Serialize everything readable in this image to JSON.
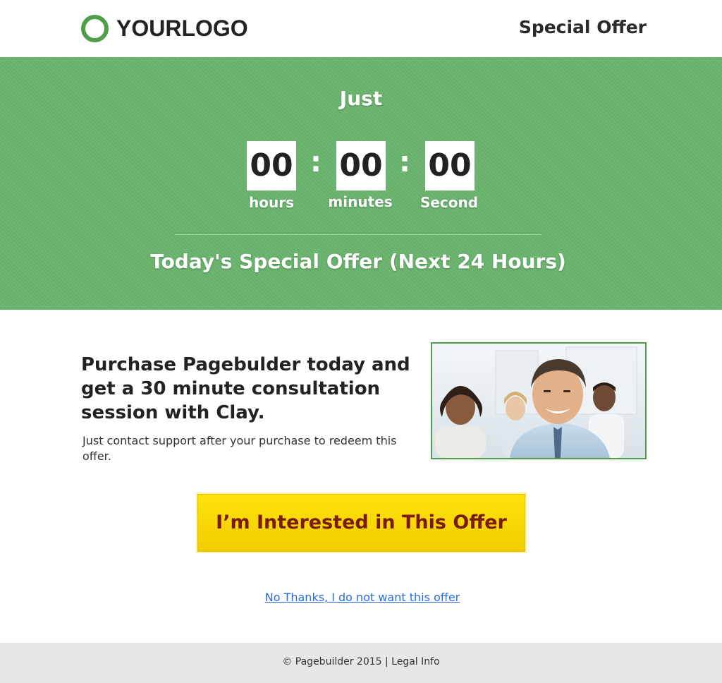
{
  "header": {
    "logo_text": "YOURLOGO",
    "title": "Special Offer"
  },
  "hero": {
    "intro": "Just",
    "timer": {
      "hours": "00",
      "minutes": "00",
      "seconds": "00",
      "separator": ":",
      "hours_label": "hours",
      "minutes_label": "minutes",
      "seconds_label": "Second"
    },
    "offer_text": "Today's Special Offer (Next 24 Hours)"
  },
  "content": {
    "headline": "Purchase Pagebulder today and get a 30 minute consultation session with Clay.",
    "subtext": "Just contact support after your purchase to redeem this offer."
  },
  "cta": {
    "label": "I’m Interested in This Offer"
  },
  "decline": {
    "label": "No Thanks, I do not want this offer"
  },
  "footer": {
    "text": "© Pagebuilder 2015 | Legal Info"
  },
  "colors": {
    "brand_green": "#4e9e4a",
    "hero_green": "#69b36c",
    "cta_yellow": "#f5d200",
    "cta_text": "#7a1b10",
    "link_blue": "#2a6ad9",
    "footer_bg": "#e7e7e7"
  }
}
